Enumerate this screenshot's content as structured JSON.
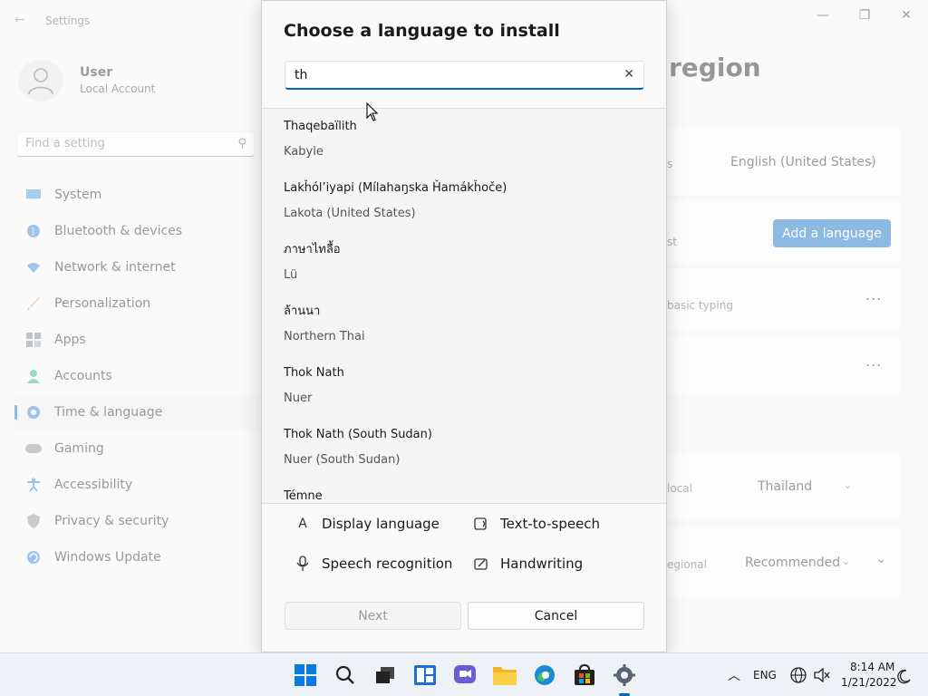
{
  "settings": {
    "app_title": "Settings",
    "user": {
      "name": "User",
      "account_type": "Local Account"
    },
    "search_placeholder": "Find a setting",
    "nav": [
      {
        "label": "System",
        "icon": "monitor-icon"
      },
      {
        "label": "Bluetooth & devices",
        "icon": "bluetooth-icon"
      },
      {
        "label": "Network & internet",
        "icon": "wifi-icon"
      },
      {
        "label": "Personalization",
        "icon": "brush-icon"
      },
      {
        "label": "Apps",
        "icon": "apps-icon"
      },
      {
        "label": "Accounts",
        "icon": "person-icon"
      },
      {
        "label": "Time & language",
        "icon": "globe-clock-icon",
        "active": true
      },
      {
        "label": "Gaming",
        "icon": "gamepad-icon"
      },
      {
        "label": "Accessibility",
        "icon": "accessibility-icon"
      },
      {
        "label": "Privacy & security",
        "icon": "shield-icon"
      },
      {
        "label": "Windows Update",
        "icon": "update-icon"
      }
    ],
    "page_title_partial": "region",
    "display_language_value": "English (United States)",
    "display_language_label_partial": "s",
    "add_language_button": "Add a language",
    "preferred_languages_label_partial": "st",
    "lang_item_caption_partial": "basic typing",
    "country_label_partial": "local",
    "country_value": "Thailand",
    "regional_format_label_partial": "egional",
    "regional_format_value": "Recommended",
    "more_options": "...",
    "win_controls": {
      "minimize": "—",
      "maximize": "❐",
      "close": "✕"
    }
  },
  "dialog": {
    "title": "Choose a language to install",
    "search_value": "th",
    "languages": [
      {
        "native": "Thaqebaïlith",
        "english": "Kabyle"
      },
      {
        "native": "Lakȟól’iyapi (Míla­haŋska Ȟamákȟoče)",
        "english": "Lakota (United States)"
      },
      {
        "native": "ภาษาไทลื้อ",
        "english": "Lü"
      },
      {
        "native": "ล้านนา",
        "english": "Northern Thai"
      },
      {
        "native": "Thok Nath",
        "english": "Nuer"
      },
      {
        "native": "Thok Nath (South Sudan)",
        "english": "Nuer (South Sudan)"
      },
      {
        "native": "Témne",
        "english": ""
      }
    ],
    "features": [
      {
        "label": "Display language",
        "icon": "display-language-icon"
      },
      {
        "label": "Text-to-speech",
        "icon": "text-to-speech-icon"
      },
      {
        "label": "Speech recognition",
        "icon": "microphone-icon"
      },
      {
        "label": "Handwriting",
        "icon": "handwriting-icon"
      }
    ],
    "next_button": "Next",
    "cancel_button": "Cancel"
  },
  "taskbar": {
    "apps": [
      "start-icon",
      "search-icon",
      "task-view-icon",
      "widgets-icon",
      "chat-icon",
      "file-explorer-icon",
      "edge-icon",
      "store-icon",
      "settings-icon"
    ],
    "tray": {
      "language": "ENG",
      "time": "8:14 AM",
      "date": "1/21/2022"
    }
  },
  "colors": {
    "accent": "#0067c0",
    "window_bg": "#f3f3f3",
    "dialog_bg": "#f9f9f9"
  }
}
